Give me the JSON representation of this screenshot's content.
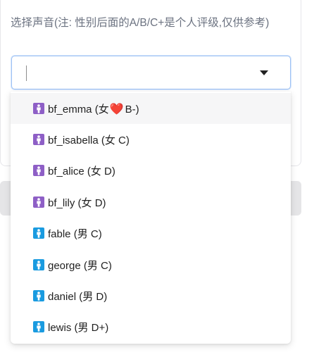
{
  "field": {
    "label": "选择声音(注: 性别后面的A/B/C+是个人评级,仅供参考)",
    "value": ""
  },
  "colors": {
    "female_icon": "#8e5fc6",
    "male_icon": "#1a9be0",
    "focus_border": "#9ec2f5",
    "heart": "#e5202e"
  },
  "options": [
    {
      "name": "bf_emma",
      "prefix": "(女",
      "heart": "❤️",
      "suffix": "B-)",
      "icon": "female-person-icon"
    },
    {
      "name": "bf_isabella",
      "text": "(女 C)",
      "icon": "female-person-icon"
    },
    {
      "name": "bf_alice",
      "text": "(女 D)",
      "icon": "female-person-icon"
    },
    {
      "name": "bf_lily",
      "text": "(女 D)",
      "icon": "female-person-icon"
    },
    {
      "name": "fable",
      "text": "(男 C)",
      "icon": "male-person-icon"
    },
    {
      "name": "george",
      "text": "(男 C)",
      "icon": "male-person-icon"
    },
    {
      "name": "daniel",
      "text": "(男 D)",
      "icon": "male-person-icon"
    },
    {
      "name": "lewis",
      "text": "(男 D+)",
      "icon": "male-person-icon"
    }
  ]
}
